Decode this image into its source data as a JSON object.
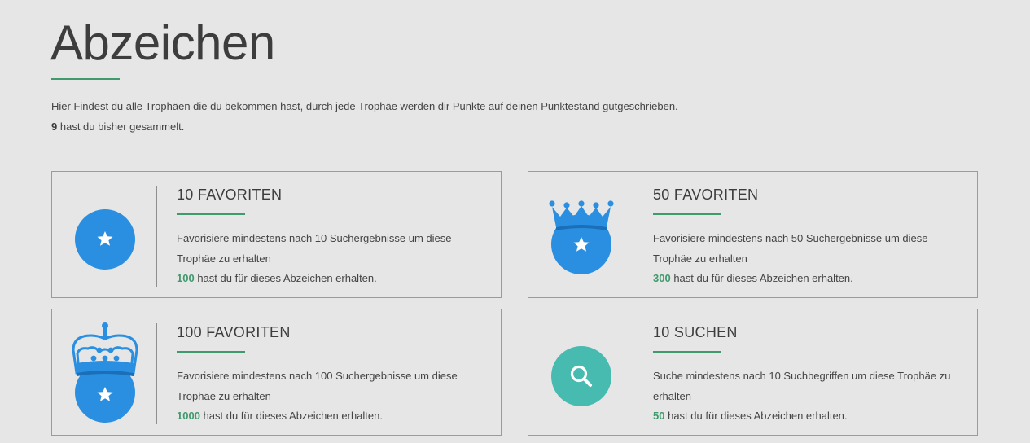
{
  "page": {
    "title": "Abzeichen",
    "intro_line": "Hier Findest du alle Trophäen die du bekommen hast, durch jede Trophäe werden dir Punkte auf deinen Punktestand gutgeschrieben.",
    "collected_count": "9",
    "collected_suffix": "hast du bisher gesammelt."
  },
  "colors": {
    "accent_green": "#3f9a6c",
    "badge_blue": "#2a8fe0",
    "badge_teal": "#47bbb0",
    "background": "#e6e6e6"
  },
  "badges": [
    {
      "title": "10 FAVORITEN",
      "description": "Favorisiere mindestens nach 10 Suchergebnisse um diese Trophäe zu erhalten",
      "points": "100",
      "points_suffix": "hast du für dieses Abzeichen erhalten.",
      "icon": "star-badge-icon"
    },
    {
      "title": "50 FAVORITEN",
      "description": "Favorisiere mindestens nach 50 Suchergebnisse um diese Trophäe zu erhalten",
      "points": "300",
      "points_suffix": "hast du für dieses Abzeichen erhalten.",
      "icon": "crown-star-badge-icon"
    },
    {
      "title": "100 FAVORITEN",
      "description": "Favorisiere mindestens nach 100 Suchergebnisse um diese Trophäe zu erhalten",
      "points": "1000",
      "points_suffix": "hast du für dieses Abzeichen erhalten.",
      "icon": "royal-crown-star-badge-icon"
    },
    {
      "title": "10 SUCHEN",
      "description": "Suche mindestens nach 10 Suchbegriffen um diese Trophäe zu erhalten",
      "points": "50",
      "points_suffix": "hast du für dieses Abzeichen erhalten.",
      "icon": "search-badge-icon"
    }
  ]
}
